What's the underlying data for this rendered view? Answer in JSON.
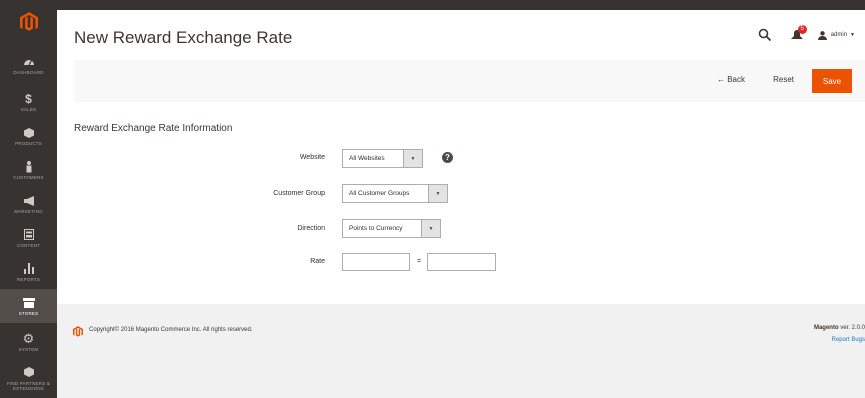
{
  "sidebar": {
    "items": [
      {
        "label": "DASHBOARD",
        "icon": "dashboard-icon"
      },
      {
        "label": "SALES",
        "icon": "dollar-icon"
      },
      {
        "label": "PRODUCTS",
        "icon": "cube-icon"
      },
      {
        "label": "CUSTOMERS",
        "icon": "person-icon"
      },
      {
        "label": "MARKETING",
        "icon": "megaphone-icon"
      },
      {
        "label": "CONTENT",
        "icon": "content-icon"
      },
      {
        "label": "REPORTS",
        "icon": "bar-chart-icon"
      },
      {
        "label": "STORES",
        "icon": "store-icon"
      },
      {
        "label": "SYSTEM",
        "icon": "gear-icon"
      },
      {
        "label": "FIND PARTNERS & EXTENSIONS",
        "icon": "partners-icon"
      }
    ],
    "active": "STORES"
  },
  "header": {
    "title": "New Reward Exchange Rate",
    "notifications_count": "5",
    "user": "admin"
  },
  "actions": {
    "back": "← Back",
    "reset": "Reset",
    "save": "Save"
  },
  "form": {
    "section_title": "Reward Exchange Rate Information",
    "website": {
      "label": "Website",
      "value": "All Websites"
    },
    "customer_group": {
      "label": "Customer Group",
      "value": "All Customer Groups"
    },
    "direction": {
      "label": "Direction",
      "value": "Points to Currency"
    },
    "rate": {
      "label": "Rate",
      "value_left": "",
      "value_right": "",
      "separator": "="
    }
  },
  "footer": {
    "copyright": "Copyright© 2016 Magento Commerce Inc. All rights reserved.",
    "brand": "Magento",
    "version": "ver. 2.0.0",
    "report_bugs": "Report Bugs"
  },
  "colors": {
    "sidebar_bg": "#373330",
    "accent": "#eb5202",
    "link": "#1979c3"
  }
}
